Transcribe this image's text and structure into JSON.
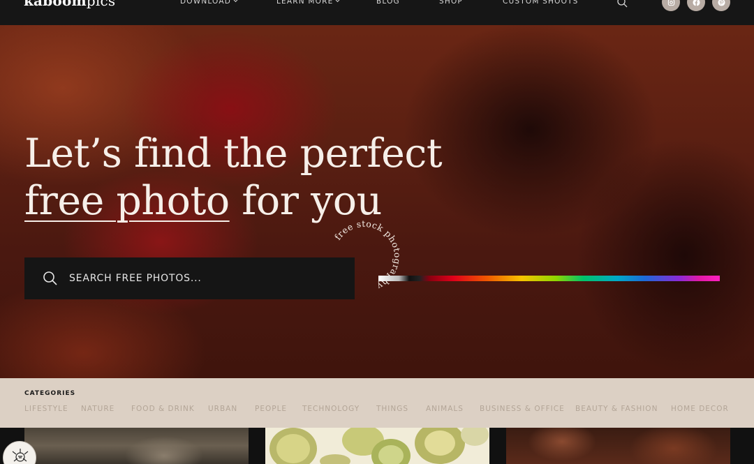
{
  "brand": {
    "bold": "kaboom",
    "light": "pics"
  },
  "nav": {
    "items": [
      {
        "label": "DOWNLOAD",
        "has_menu": true
      },
      {
        "label": "LEARN MORE",
        "has_menu": true
      },
      {
        "label": "BLOG",
        "has_menu": false
      },
      {
        "label": "SHOP",
        "has_menu": false
      },
      {
        "label": "CUSTOM SHOOTS",
        "has_menu": false
      }
    ],
    "search_icon": "search-icon",
    "social": [
      "instagram-icon",
      "facebook-icon",
      "pinterest-icon"
    ]
  },
  "hero": {
    "line1": "Let’s find the perfect",
    "line2_underlined": "free photo",
    "line2_rest": " for you",
    "search_placeholder": "SEARCH FREE PHOTOS...",
    "badge_text": "free stock photography"
  },
  "categories": {
    "title": "CATEGORIES",
    "items": [
      "LIFESTYLE",
      "NATURE",
      "FOOD & DRINK",
      "URBAN",
      "PEOPLE",
      "TECHNOLOGY",
      "THINGS",
      "ANIMALS",
      "BUSINESS & OFFICE",
      "BEAUTY & FASHION",
      "HOME DECOR"
    ]
  },
  "colors": {
    "nav_bg": "#161616",
    "categories_bg": "#dcd0c4",
    "category_text": "#b3a597",
    "social_bg": "#b8aca4"
  }
}
